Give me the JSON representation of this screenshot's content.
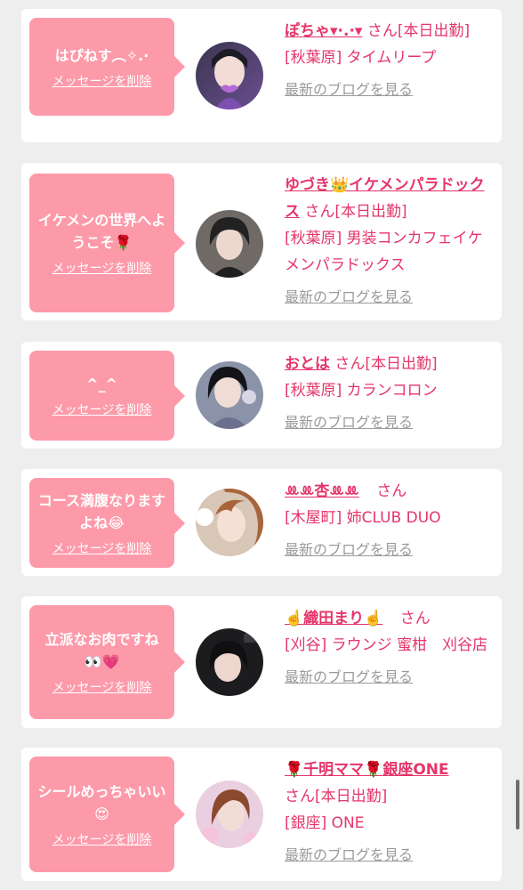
{
  "cards": [
    {
      "message": "はぴねす︵✧.·",
      "delete_label": "メッセージを削除",
      "name": "ぽちゃ▾·.·▾",
      "san_suffix": "さん[本日出勤]",
      "shop": "[秋葉原] タイムリープ",
      "blog_label": "最新のブログを見る"
    },
    {
      "message": "イケメンの世界へようこそ🌹",
      "delete_label": "メッセージを削除",
      "name": "ゆづき👑イケメンパラドックス",
      "san_suffix": "さん[本日出勤]",
      "shop": "[秋葉原] 男装コンカフェイケメンパラドックス",
      "blog_label": "最新のブログを見る"
    },
    {
      "message": "^_^",
      "delete_label": "メッセージを削除",
      "name": "おとは",
      "san_suffix": "さん[本日出勤]",
      "shop": "[秋葉原] カランコロン",
      "blog_label": "最新のブログを見る"
    },
    {
      "message": "コース満腹なりますよね😂",
      "delete_label": "メッセージを削除",
      "name": "ꔛꔛ杏ꔛꔛ",
      "san_suffix": "さん",
      "shop": "[木屋町] 姉CLUB DUO",
      "blog_label": "最新のブログを見る"
    },
    {
      "message": "立派なお肉ですね👀💗",
      "delete_label": "メッセージを削除",
      "name": "☝️織田まり☝️",
      "san_suffix": "さん",
      "shop": "[刈谷] ラウンジ 蜜柑　刈谷店",
      "blog_label": "最新のブログを見る"
    },
    {
      "message": "シールめっちゃいい😍",
      "delete_label": "メッセージを削除",
      "name": "🌹千明ママ🌹銀座ONE",
      "san_suffix": "さん[本日出勤]",
      "shop": "[銀座] ONE",
      "blog_label": "最新のブログを見る"
    }
  ],
  "colors": {
    "page_background": "#eeeeef",
    "card_background": "#ffffff",
    "bubble": "#fd9aaa",
    "accent_pink": "#e5356b",
    "blog_link_gray": "#9a9a9a"
  },
  "icons": [
    "avatar-photo"
  ]
}
